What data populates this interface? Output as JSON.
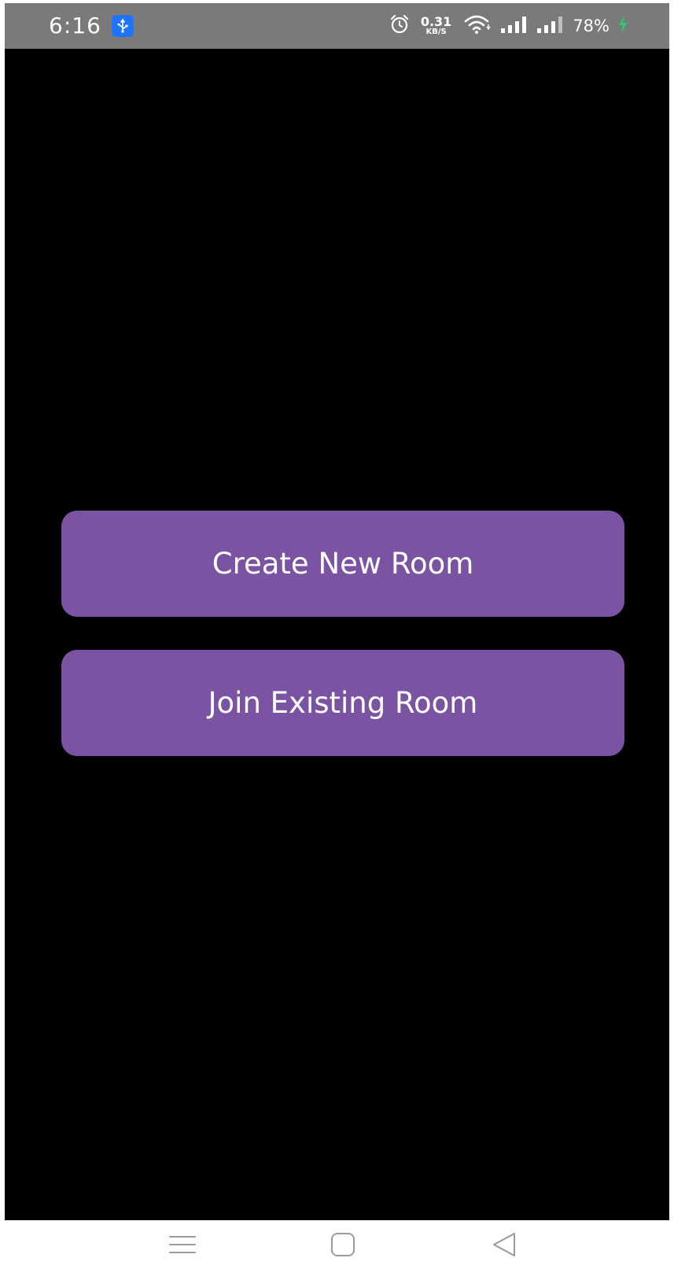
{
  "status_bar": {
    "time": "6:16",
    "net_speed_value": "0.31",
    "net_speed_unit": "KB/S",
    "battery_percent": "78%",
    "icons": [
      "usb-icon",
      "alarm-icon",
      "wifi-icon",
      "signal-icon",
      "signal-icon",
      "battery-icon",
      "charging-icon"
    ]
  },
  "main": {
    "create_room_label": "Create New Room",
    "join_room_label": "Join Existing Room"
  },
  "nav_bar": {
    "icons": [
      "menu-icon",
      "home-icon",
      "back-icon"
    ]
  },
  "colors": {
    "background": "#000000",
    "status_bar": "#7a7a7a",
    "button": "#7b53a3",
    "button_text": "#ffffff",
    "usb_badge": "#1f74ff",
    "charging": "#2ecc71"
  }
}
